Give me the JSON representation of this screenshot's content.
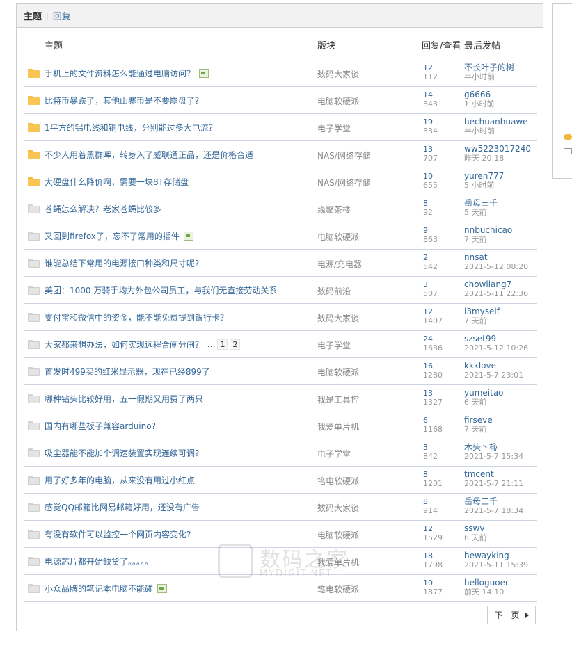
{
  "tabs": {
    "active": "主题",
    "other": "回复"
  },
  "columns": {
    "subject": "主题",
    "forum": "版块",
    "stats": "回复/查看",
    "last_post": "最后发帖"
  },
  "threads": [
    {
      "title": "手机上的文件资料怎么能通过电脑访问？",
      "attachment": true,
      "hot": true,
      "forum": "数码大家谈",
      "replies": "12",
      "views": "112",
      "last_user": "不长叶子的树",
      "last_time": "半小时前"
    },
    {
      "title": "比特币暴跌了，其他山寨币是不要崩盘了？",
      "attachment": false,
      "hot": true,
      "forum": "电脑软硬派",
      "replies": "14",
      "views": "343",
      "last_user": "g6666",
      "last_time": "1 小时前"
    },
    {
      "title": "1平方的铝电线和铜电线，分别能过多大电流？",
      "attachment": false,
      "hot": true,
      "forum": "电子学堂",
      "replies": "19",
      "views": "334",
      "last_user": "hechuanhuawe",
      "last_time": "半小时前"
    },
    {
      "title": "不少人用着黑群晖，转身入了威联通正品，还是价格合适",
      "attachment": false,
      "hot": true,
      "forum": "NAS/网络存储",
      "replies": "13",
      "views": "707",
      "last_user": "ww5223017240",
      "last_time": "昨天 20:18"
    },
    {
      "title": "大硬盘什么降价啊，需要一块8T存储盘",
      "attachment": false,
      "hot": true,
      "forum": "NAS/网络存储",
      "replies": "10",
      "views": "655",
      "last_user": "yuren777",
      "last_time": "5 小时前"
    },
    {
      "title": "苍蝇怎么解决？老家苍蝇比较多",
      "attachment": false,
      "hot": false,
      "forum": "缘聚茶楼",
      "replies": "8",
      "views": "92",
      "last_user": "岳母三千",
      "last_time": "5 天前"
    },
    {
      "title": "又回到firefox了，忘不了常用的插件",
      "attachment": true,
      "hot": false,
      "forum": "电脑软硬派",
      "replies": "9",
      "views": "863",
      "last_user": "nnbuchicao",
      "last_time": "7 天前"
    },
    {
      "title": "谁能总结下常用的电源接口种类和尺寸呢?",
      "attachment": false,
      "hot": false,
      "forum": "电源/充电器",
      "replies": "2",
      "views": "542",
      "last_user": "nnsat",
      "last_time": "2021-5-12 08:20"
    },
    {
      "title": "美团：1000 万骑手均为外包公司员工，与我们无直接劳动关系",
      "attachment": false,
      "hot": false,
      "forum": "数码前沿",
      "replies": "3",
      "views": "507",
      "last_user": "chowliang7",
      "last_time": "2021-5-11 22:36"
    },
    {
      "title": "支付宝和微信中的资金，能不能免费提到银行卡？",
      "attachment": false,
      "hot": false,
      "forum": "数码大家谈",
      "replies": "12",
      "views": "1407",
      "last_user": "i3myself",
      "last_time": "7 天前"
    },
    {
      "title": "大家都来想办法，如何实现远程合闸分闸？",
      "attachment": false,
      "hot": false,
      "forum": "电子学堂",
      "replies": "24",
      "views": "1636",
      "last_user": "szset99",
      "last_time": "2021-5-12 10:26",
      "pages": [
        "1",
        "2"
      ],
      "ellipsis": "..."
    },
    {
      "title": "首发时499买的红米显示器，现在已经899了",
      "attachment": false,
      "hot": false,
      "forum": "电脑软硬派",
      "replies": "16",
      "views": "1280",
      "last_user": "kkklove",
      "last_time": "2021-5-7 23:01"
    },
    {
      "title": "哪种钻头比较好用，五一假期又用费了两只",
      "attachment": false,
      "hot": false,
      "forum": "我是工具控",
      "replies": "13",
      "views": "1327",
      "last_user": "yumeitao",
      "last_time": "6 天前"
    },
    {
      "title": "国内有哪些板子兼容arduino?",
      "attachment": false,
      "hot": false,
      "forum": "我爱单片机",
      "replies": "6",
      "views": "1168",
      "last_user": "firseve",
      "last_time": "7 天前"
    },
    {
      "title": "吸尘器能不能加个调速装置实现连续可调?",
      "attachment": false,
      "hot": false,
      "forum": "电子学堂",
      "replies": "3",
      "views": "842",
      "last_user": "木头丶杺",
      "last_time": "2021-5-7 15:34"
    },
    {
      "title": "用了好多年的电脑，从来没有用过小红点",
      "attachment": false,
      "hot": false,
      "forum": "笔电软硬派",
      "replies": "8",
      "views": "1201",
      "last_user": "tmcent",
      "last_time": "2021-5-7 21:11"
    },
    {
      "title": "感觉QQ邮箱比网易邮箱好用，还没有广告",
      "attachment": false,
      "hot": false,
      "forum": "数码大家谈",
      "replies": "8",
      "views": "914",
      "last_user": "岳母三千",
      "last_time": "2021-5-7 18:34"
    },
    {
      "title": "有没有软件可以监控一个网页内容变化?",
      "attachment": false,
      "hot": false,
      "forum": "电脑软硬派",
      "replies": "12",
      "views": "1529",
      "last_user": "sswv",
      "last_time": "6 天前"
    },
    {
      "title": "电源芯片都开始缺货了。。。。。",
      "attachment": false,
      "hot": false,
      "forum": "我爱单片机",
      "replies": "18",
      "views": "1798",
      "last_user": "hewayking",
      "last_time": "2021-5-11 15:39"
    },
    {
      "title": "小众品牌的笔记本电脑不能碰",
      "attachment": true,
      "hot": false,
      "forum": "笔电软硬派",
      "replies": "10",
      "views": "1877",
      "last_user": "helloguoer",
      "last_time": "前天 14:10"
    }
  ],
  "pagination": {
    "next_label": "下一页"
  },
  "watermark": {
    "text": "数码之家",
    "subtext": "MYDIGIT.NET"
  },
  "colors": {
    "link": "#336699",
    "hot_folder": "#f9c552",
    "cold_folder": "#e4e4e4",
    "muted": "#999999"
  }
}
